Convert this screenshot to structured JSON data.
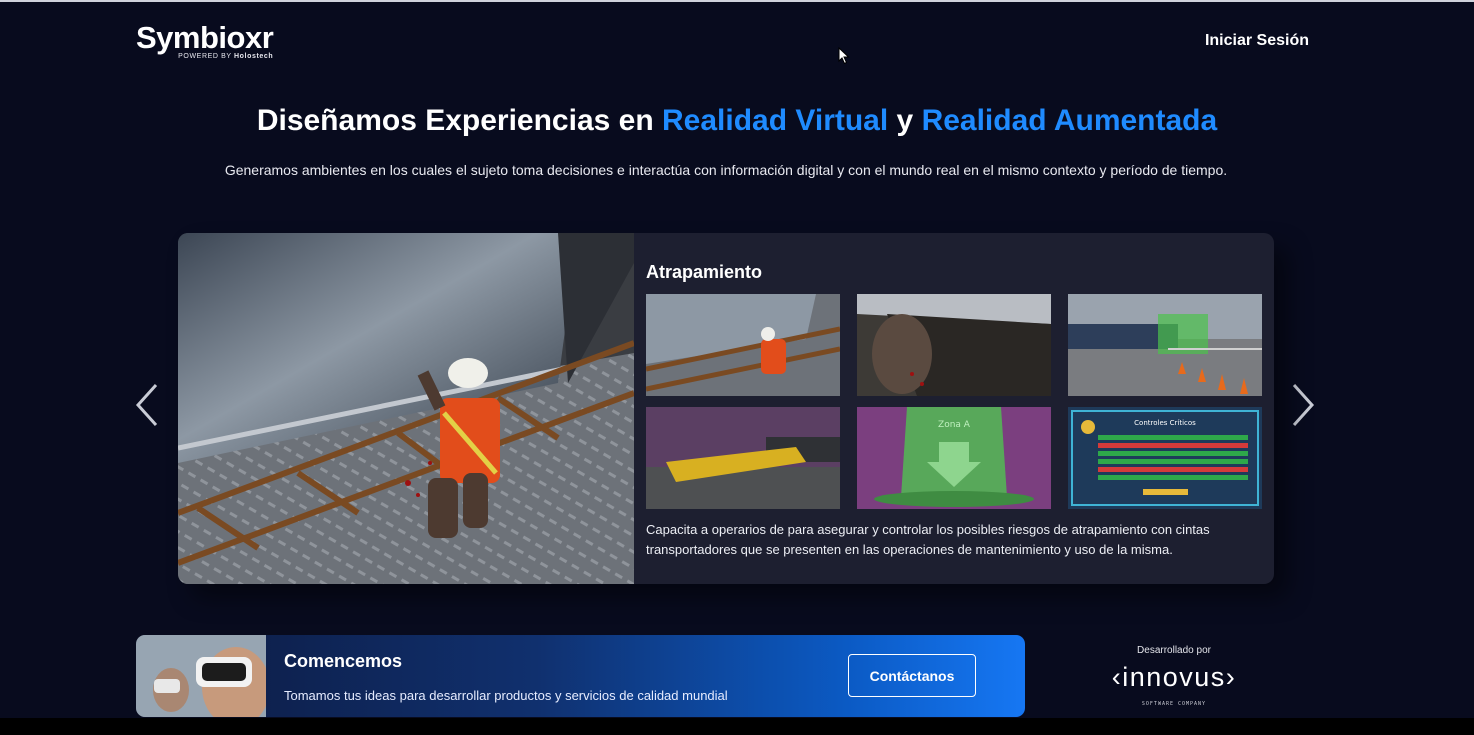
{
  "header": {
    "logo_name": "Symbioxr",
    "logo_powered": "POWERED BY",
    "logo_company": "Holostech",
    "login_label": "Iniciar Sesión"
  },
  "hero": {
    "title_part1": "Diseñamos Experiencias en ",
    "title_highlight1": "Realidad Virtual",
    "title_part2": " y ",
    "title_highlight2": "Realidad Aumentada",
    "subtitle": "Generamos ambientes en los cuales el sujeto toma decisiones e interactúa con información digital y con el mundo real en el mismo contexto y período de tiempo."
  },
  "carousel": {
    "prev_icon": "chevron-left-icon",
    "next_icon": "chevron-right-icon",
    "slide": {
      "title": "Atrapamiento",
      "description": "Capacita a operarios de para asegurar y controlar los posibles riesgos de atrapamiento con cintas transportadores que se presenten en las operaciones de mantenimiento y uso de la misma.",
      "thumbnails": {
        "zone_label": "Zona A",
        "panel_title": "Controles Críticos"
      }
    }
  },
  "cta": {
    "title": "Comencemos",
    "text": "Tomamos tus ideas para desarrollar productos y servicios de calidad mundial",
    "button_label": "Contáctanos"
  },
  "developer": {
    "label": "Desarrollado por",
    "logo": "‹innovus›",
    "tagline": "SOFTWARE COMPANY"
  },
  "colors": {
    "background": "#080b1e",
    "accent": "#1f8bff",
    "card": "#1d1f30"
  }
}
